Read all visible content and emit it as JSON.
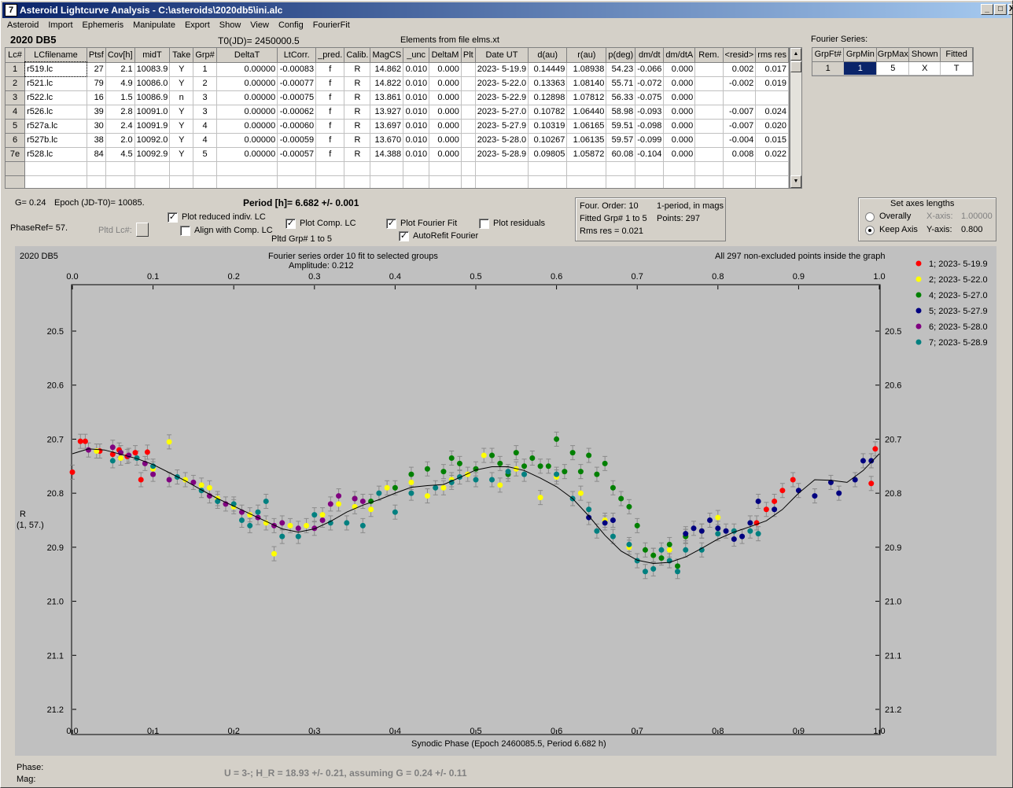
{
  "window": {
    "title": "Asteroid Lightcurve Analysis - C:\\asteroids\\2020db5\\ini.alc",
    "icon_name": "lightcurve-app-icon",
    "buttons": [
      "_",
      "□",
      "X"
    ]
  },
  "menu": [
    "Asteroid",
    "Import",
    "Ephemeris",
    "Manipulate",
    "Export",
    "Show",
    "View",
    "Config",
    "FourierFit"
  ],
  "header": {
    "asteroid": "2020 DB5",
    "t0": "T0(JD)= 2450000.5",
    "elements": "Elements from file elms.xt"
  },
  "table": {
    "columns": [
      "Lc#",
      "LCfilename",
      "Ptsf",
      "Cov[h]",
      "midT",
      "Take",
      "Grp#",
      "DeltaT",
      "LtCorr.",
      "_pred.",
      "Calib.",
      "MagCS",
      "_unc",
      "DeltaM",
      "Plt",
      "Date UT",
      "d(au)",
      "r(au)",
      "p(deg)",
      "dm/dt",
      "dm/dtA",
      "Rem.",
      "<resid>",
      "rms res"
    ],
    "rows": [
      [
        "1",
        "r519.lc",
        "27",
        "2.1",
        "10083.9",
        "Y",
        "1",
        "0.00000",
        "-0.00083",
        "f",
        "R",
        "14.862",
        "0.010",
        "0.000",
        "",
        "2023- 5-19.9",
        "0.14449",
        "1.08938",
        "54.23",
        "-0.066",
        "0.000",
        "",
        "0.002",
        "0.017"
      ],
      [
        "2",
        "r521.lc",
        "79",
        "4.9",
        "10086.0",
        "Y",
        "2",
        "0.00000",
        "-0.00077",
        "f",
        "R",
        "14.822",
        "0.010",
        "0.000",
        "",
        "2023- 5-22.0",
        "0.13363",
        "1.08140",
        "55.71",
        "-0.072",
        "0.000",
        "",
        "-0.002",
        "0.019"
      ],
      [
        "3",
        "r522.lc",
        "16",
        "1.5",
        "10086.9",
        "n",
        "3",
        "0.00000",
        "-0.00075",
        "f",
        "R",
        "13.861",
        "0.010",
        "0.000",
        "",
        "2023- 5-22.9",
        "0.12898",
        "1.07812",
        "56.33",
        "-0.075",
        "0.000",
        "",
        "",
        ""
      ],
      [
        "4",
        "r526.lc",
        "39",
        "2.8",
        "10091.0",
        "Y",
        "3",
        "0.00000",
        "-0.00062",
        "f",
        "R",
        "13.927",
        "0.010",
        "0.000",
        "",
        "2023- 5-27.0",
        "0.10782",
        "1.06440",
        "58.98",
        "-0.093",
        "0.000",
        "",
        "-0.007",
        "0.024"
      ],
      [
        "5",
        "r527a.lc",
        "30",
        "2.4",
        "10091.9",
        "Y",
        "4",
        "0.00000",
        "-0.00060",
        "f",
        "R",
        "13.697",
        "0.010",
        "0.000",
        "",
        "2023- 5-27.9",
        "0.10319",
        "1.06165",
        "59.51",
        "-0.098",
        "0.000",
        "",
        "-0.007",
        "0.020"
      ],
      [
        "6",
        "r527b.lc",
        "38",
        "2.0",
        "10092.0",
        "Y",
        "4",
        "0.00000",
        "-0.00059",
        "f",
        "R",
        "13.670",
        "0.010",
        "0.000",
        "",
        "2023- 5-28.0",
        "0.10267",
        "1.06135",
        "59.57",
        "-0.099",
        "0.000",
        "",
        "-0.004",
        "0.015"
      ],
      [
        "7e",
        "r528.lc",
        "84",
        "4.5",
        "10092.9",
        "Y",
        "5",
        "0.00000",
        "-0.00057",
        "f",
        "R",
        "14.388",
        "0.010",
        "0.000",
        "",
        "2023- 5-28.9",
        "0.09805",
        "1.05872",
        "60.08",
        "-0.104",
        "0.000",
        "",
        "0.008",
        "0.022"
      ]
    ]
  },
  "fourier_series": {
    "label": "Fourier Series:",
    "columns": [
      "GrpFt#",
      "GrpMin",
      "GrpMax",
      "Shown",
      "Fitted"
    ],
    "row": [
      "1",
      "1",
      "5",
      "X",
      "T"
    ]
  },
  "info": {
    "g": "G= 0.24",
    "epoch": "Epoch (JD-T0)= 10085.",
    "period": "Period [h]= 6.682 +/- 0.001",
    "phaseref": "PhaseRef= 57.",
    "pltd_lc": "Pltd Lc#:",
    "pltd_grp": "Pltd Grp#  1   to   5"
  },
  "checkboxes": {
    "plot_reduced": {
      "label": "Plot reduced indiv. LC",
      "checked": true
    },
    "align_comp": {
      "label": "Align with Comp. LC",
      "checked": false
    },
    "plot_comp": {
      "label": "Plot Comp. LC",
      "checked": true
    },
    "plot_fourier": {
      "label": "Plot Fourier Fit",
      "checked": true
    },
    "autorefit": {
      "label": "AutoRefit Fourier",
      "checked": true
    },
    "plot_residuals": {
      "label": "Plot residuals",
      "checked": false
    }
  },
  "fit_box": {
    "order": "Four. Order: 10",
    "period_mode": "1-period, in mags",
    "fitted": "Fitted Grp# 1 to 5",
    "points": "Points: 297",
    "rms": "Rms res     = 0.021"
  },
  "axes_box": {
    "title": "Set axes lengths",
    "overally": "Overally",
    "keep_axis": "Keep Axis",
    "xaxis_label": "X-axis:",
    "xaxis_value": "1.00000",
    "yaxis_label": "Y-axis:",
    "yaxis_value": "0.800",
    "selected": "keep_axis"
  },
  "plot": {
    "name": "2020 DB5",
    "subtitle": "Fourier series order 10 fit to selected groups",
    "amplitude": "Amplitude: 0.212",
    "points_note": "All 297 non-excluded points inside the graph",
    "ylabel1": "R",
    "ylabel2": "(1, 57.)",
    "xlabel": "Synodic Phase (Epoch 2460085.5, Period 6.682 h)"
  },
  "footer": {
    "phase": "Phase:",
    "mag": "Mag:",
    "result": "U = 3-; H_R = 18.93 +/- 0.21, assuming G = 0.24 +/- 0.11"
  },
  "chart_data": {
    "type": "scatter",
    "title": "Fourier series order 10 fit to selected groups",
    "xlabel": "Synodic Phase (Epoch 2460085.5, Period 6.682 h)",
    "ylabel": "R",
    "xlim": [
      0.0,
      1.0
    ],
    "ylim": [
      21.2,
      20.4
    ],
    "x_ticks": [
      0.0,
      0.1,
      0.2,
      0.3,
      0.4,
      0.5,
      0.6,
      0.7,
      0.8,
      0.9,
      1.0
    ],
    "y_ticks": [
      20.5,
      20.6,
      20.7,
      20.8,
      20.9,
      21.0,
      21.1,
      21.2
    ],
    "legend_position": "right",
    "fit_curve": {
      "x": [
        0.0,
        0.02,
        0.04,
        0.06,
        0.08,
        0.1,
        0.12,
        0.14,
        0.16,
        0.18,
        0.2,
        0.22,
        0.24,
        0.26,
        0.28,
        0.3,
        0.32,
        0.34,
        0.36,
        0.38,
        0.4,
        0.42,
        0.44,
        0.46,
        0.48,
        0.5,
        0.52,
        0.54,
        0.56,
        0.58,
        0.6,
        0.62,
        0.64,
        0.66,
        0.68,
        0.7,
        0.72,
        0.74,
        0.76,
        0.78,
        0.8,
        0.82,
        0.84,
        0.86,
        0.88,
        0.9,
        0.92,
        0.94,
        0.96,
        0.98,
        1.0
      ],
      "y": [
        20.727,
        20.718,
        20.72,
        20.728,
        20.736,
        20.747,
        20.762,
        20.777,
        20.794,
        20.81,
        20.824,
        20.838,
        20.852,
        20.866,
        20.872,
        20.866,
        20.852,
        20.835,
        20.822,
        20.812,
        20.8,
        20.789,
        20.786,
        20.784,
        20.771,
        20.757,
        20.751,
        20.751,
        20.758,
        20.772,
        20.788,
        20.81,
        20.842,
        20.878,
        20.907,
        20.924,
        20.93,
        20.928,
        20.918,
        20.902,
        20.885,
        20.872,
        20.862,
        20.851,
        20.83,
        20.8,
        20.775,
        20.776,
        20.78,
        20.758,
        20.727
      ]
    },
    "series": [
      {
        "name": "1; 2023- 5-19.9",
        "color": "#ff0000",
        "points": [
          [
            0.0,
            20.761
          ],
          [
            0.01,
            20.704
          ],
          [
            0.016,
            20.704
          ],
          [
            0.034,
            20.722
          ],
          [
            0.05,
            20.728
          ],
          [
            0.058,
            20.72
          ],
          [
            0.068,
            20.732
          ],
          [
            0.078,
            20.725
          ],
          [
            0.085,
            20.775
          ],
          [
            0.093,
            20.724
          ],
          [
            0.848,
            20.855
          ],
          [
            0.86,
            20.83
          ],
          [
            0.87,
            20.815
          ],
          [
            0.88,
            20.795
          ],
          [
            0.893,
            20.775
          ],
          [
            0.99,
            20.782
          ],
          [
            0.995,
            20.718
          ]
        ]
      },
      {
        "name": "2; 2023- 5-22.0",
        "color": "#ffff00",
        "points": [
          [
            0.03,
            20.722
          ],
          [
            0.06,
            20.735
          ],
          [
            0.1,
            20.755
          ],
          [
            0.12,
            20.705
          ],
          [
            0.14,
            20.775
          ],
          [
            0.16,
            20.785
          ],
          [
            0.17,
            20.79
          ],
          [
            0.18,
            20.81
          ],
          [
            0.2,
            20.825
          ],
          [
            0.22,
            20.84
          ],
          [
            0.24,
            20.855
          ],
          [
            0.25,
            20.912
          ],
          [
            0.27,
            20.86
          ],
          [
            0.29,
            20.86
          ],
          [
            0.31,
            20.84
          ],
          [
            0.33,
            20.82
          ],
          [
            0.35,
            20.825
          ],
          [
            0.37,
            20.83
          ],
          [
            0.39,
            20.79
          ],
          [
            0.42,
            20.78
          ],
          [
            0.44,
            20.805
          ],
          [
            0.46,
            20.79
          ],
          [
            0.47,
            20.775
          ],
          [
            0.49,
            20.765
          ],
          [
            0.51,
            20.73
          ],
          [
            0.53,
            20.785
          ],
          [
            0.55,
            20.755
          ],
          [
            0.58,
            20.808
          ],
          [
            0.6,
            20.77
          ],
          [
            0.63,
            20.8
          ],
          [
            0.66,
            20.85
          ],
          [
            0.69,
            20.9
          ],
          [
            0.72,
            20.915
          ],
          [
            0.74,
            20.905
          ],
          [
            0.76,
            20.88
          ],
          [
            0.78,
            20.87
          ],
          [
            0.8,
            20.845
          ]
        ]
      },
      {
        "name": "4; 2023- 5-27.0",
        "color": "#008000",
        "points": [
          [
            0.35,
            20.81
          ],
          [
            0.37,
            20.815
          ],
          [
            0.4,
            20.79
          ],
          [
            0.42,
            20.765
          ],
          [
            0.44,
            20.755
          ],
          [
            0.46,
            20.76
          ],
          [
            0.47,
            20.735
          ],
          [
            0.48,
            20.745
          ],
          [
            0.5,
            20.755
          ],
          [
            0.52,
            20.73
          ],
          [
            0.53,
            20.745
          ],
          [
            0.54,
            20.765
          ],
          [
            0.55,
            20.725
          ],
          [
            0.56,
            20.75
          ],
          [
            0.57,
            20.735
          ],
          [
            0.58,
            20.75
          ],
          [
            0.59,
            20.75
          ],
          [
            0.6,
            20.7
          ],
          [
            0.61,
            20.76
          ],
          [
            0.62,
            20.725
          ],
          [
            0.63,
            20.76
          ],
          [
            0.64,
            20.73
          ],
          [
            0.65,
            20.765
          ],
          [
            0.66,
            20.745
          ],
          [
            0.67,
            20.79
          ],
          [
            0.68,
            20.81
          ],
          [
            0.69,
            20.825
          ],
          [
            0.7,
            20.86
          ],
          [
            0.71,
            20.905
          ],
          [
            0.72,
            20.915
          ],
          [
            0.73,
            20.92
          ],
          [
            0.74,
            20.895
          ],
          [
            0.75,
            20.935
          ],
          [
            0.76,
            20.88
          ]
        ]
      },
      {
        "name": "5; 2023- 5-27.9",
        "color": "#000080",
        "points": [
          [
            0.64,
            20.845
          ],
          [
            0.66,
            20.855
          ],
          [
            0.67,
            20.85
          ],
          [
            0.76,
            20.875
          ],
          [
            0.77,
            20.865
          ],
          [
            0.78,
            20.87
          ],
          [
            0.79,
            20.85
          ],
          [
            0.8,
            20.865
          ],
          [
            0.81,
            20.87
          ],
          [
            0.82,
            20.885
          ],
          [
            0.83,
            20.88
          ],
          [
            0.84,
            20.855
          ],
          [
            0.85,
            20.815
          ],
          [
            0.87,
            20.83
          ],
          [
            0.9,
            20.795
          ],
          [
            0.92,
            20.805
          ],
          [
            0.94,
            20.78
          ],
          [
            0.95,
            20.8
          ],
          [
            0.97,
            20.775
          ],
          [
            0.98,
            20.74
          ],
          [
            0.99,
            20.74
          ]
        ]
      },
      {
        "name": "6; 2023- 5-28.0",
        "color": "#800080",
        "points": [
          [
            0.02,
            20.72
          ],
          [
            0.05,
            20.715
          ],
          [
            0.06,
            20.725
          ],
          [
            0.07,
            20.73
          ],
          [
            0.09,
            20.745
          ],
          [
            0.1,
            20.765
          ],
          [
            0.12,
            20.775
          ],
          [
            0.15,
            20.78
          ],
          [
            0.17,
            20.805
          ],
          [
            0.19,
            20.82
          ],
          [
            0.21,
            20.835
          ],
          [
            0.23,
            20.845
          ],
          [
            0.25,
            20.86
          ],
          [
            0.26,
            20.855
          ],
          [
            0.28,
            20.865
          ],
          [
            0.3,
            20.865
          ],
          [
            0.31,
            20.85
          ],
          [
            0.32,
            20.82
          ],
          [
            0.33,
            20.805
          ],
          [
            0.35,
            20.81
          ],
          [
            0.36,
            20.815
          ]
        ]
      },
      {
        "name": "7; 2023- 5-28.9",
        "color": "#008080",
        "points": [
          [
            0.05,
            20.74
          ],
          [
            0.08,
            20.735
          ],
          [
            0.1,
            20.75
          ],
          [
            0.13,
            20.77
          ],
          [
            0.16,
            20.795
          ],
          [
            0.18,
            20.815
          ],
          [
            0.2,
            20.82
          ],
          [
            0.21,
            20.85
          ],
          [
            0.22,
            20.86
          ],
          [
            0.23,
            20.835
          ],
          [
            0.24,
            20.815
          ],
          [
            0.26,
            20.88
          ],
          [
            0.28,
            20.88
          ],
          [
            0.3,
            20.84
          ],
          [
            0.32,
            20.855
          ],
          [
            0.34,
            20.855
          ],
          [
            0.36,
            20.86
          ],
          [
            0.38,
            20.8
          ],
          [
            0.4,
            20.835
          ],
          [
            0.42,
            20.8
          ],
          [
            0.45,
            20.79
          ],
          [
            0.47,
            20.78
          ],
          [
            0.48,
            20.77
          ],
          [
            0.5,
            20.775
          ],
          [
            0.52,
            20.775
          ],
          [
            0.54,
            20.76
          ],
          [
            0.56,
            20.765
          ],
          [
            0.6,
            20.765
          ],
          [
            0.62,
            20.81
          ],
          [
            0.64,
            20.83
          ],
          [
            0.65,
            20.87
          ],
          [
            0.67,
            20.88
          ],
          [
            0.69,
            20.895
          ],
          [
            0.7,
            20.925
          ],
          [
            0.71,
            20.945
          ],
          [
            0.72,
            20.94
          ],
          [
            0.73,
            20.905
          ],
          [
            0.74,
            20.925
          ],
          [
            0.75,
            20.945
          ],
          [
            0.76,
            20.905
          ],
          [
            0.78,
            20.905
          ],
          [
            0.8,
            20.875
          ],
          [
            0.82,
            20.87
          ],
          [
            0.84,
            20.87
          ],
          [
            0.85,
            20.875
          ]
        ]
      }
    ]
  }
}
